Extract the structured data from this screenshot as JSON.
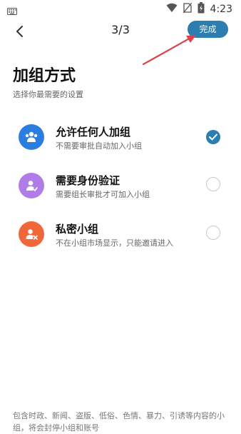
{
  "status_bar": {
    "time": "4:23"
  },
  "nav": {
    "step": "3/3",
    "done_label": "完成"
  },
  "page": {
    "title": "加组方式",
    "subtitle": "选择你最需要的设置"
  },
  "options": [
    {
      "label": "允许任何人加组",
      "desc": "不需要审批自动加入小组",
      "icon": "people-icon",
      "color": "#2b7ee0",
      "selected": true
    },
    {
      "label": "需要身份验证",
      "desc": "需要组长审批才可加入小组",
      "icon": "user-verify-icon",
      "color": "#b07de8",
      "selected": false
    },
    {
      "label": "私密小组",
      "desc": "不在小组市场显示，只能邀请进入",
      "icon": "private-user-icon",
      "color": "#f0673a",
      "selected": false
    }
  ],
  "footer": {
    "note": "包含时政、新闻、盗版、低俗、色情、暴力、引诱等内容的小组，将会封停小组和账号"
  },
  "colors": {
    "accent": "#2c7db0",
    "arrow": "#e0404a"
  }
}
